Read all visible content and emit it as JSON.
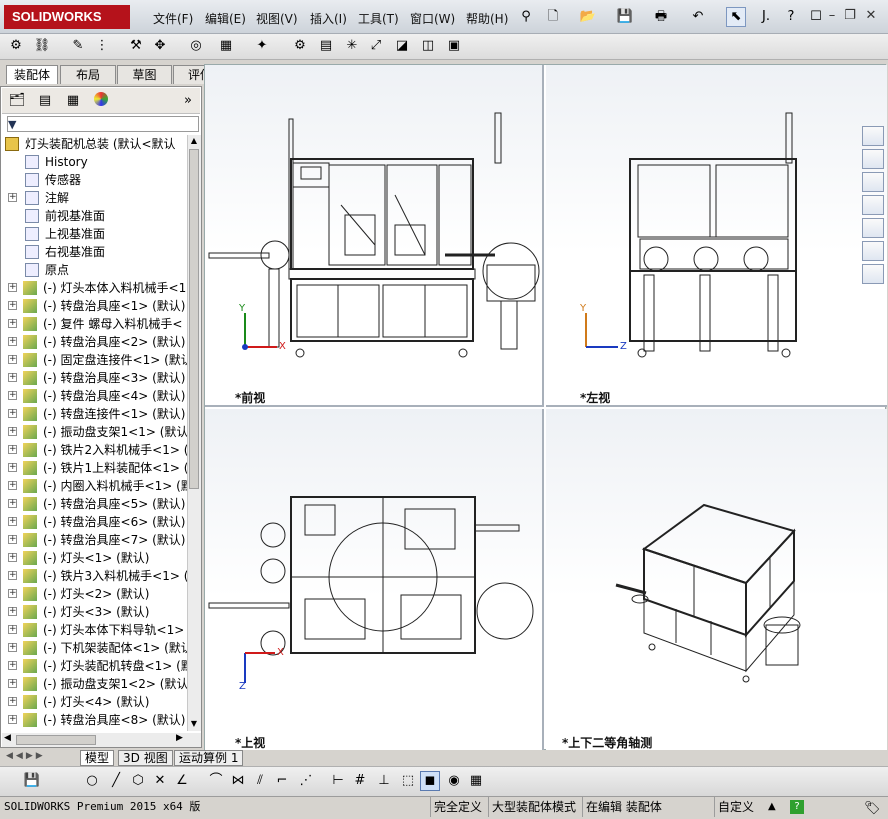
{
  "app": {
    "logo_text": "SOLIDWORKS",
    "brand_color": "#b5121b"
  },
  "menu": [
    "文件(F)",
    "编辑(E)",
    "视图(V)",
    "插入(I)",
    "工具(T)",
    "窗口(W)",
    "帮助(H)"
  ],
  "command_tabs": [
    "装配体",
    "布局",
    "草图",
    "评估"
  ],
  "tree": {
    "root": "灯头装配机总装  (默认<默认",
    "items": [
      {
        "label": "History",
        "icon": "history-icon",
        "expand": false
      },
      {
        "label": "传感器",
        "icon": "sensor-icon",
        "expand": false
      },
      {
        "label": "注解",
        "icon": "annotation-icon",
        "expand": true
      },
      {
        "label": "前视基准面",
        "icon": "plane-icon",
        "expand": false
      },
      {
        "label": "上视基准面",
        "icon": "plane-icon",
        "expand": false
      },
      {
        "label": "右视基准面",
        "icon": "plane-icon",
        "expand": false
      },
      {
        "label": "原点",
        "icon": "origin-icon",
        "expand": false
      },
      {
        "label": "(-) 灯头本体入料机械手<1",
        "icon": "subassembly-icon",
        "expand": true
      },
      {
        "label": "(-) 转盘治具座<1> (默认)",
        "icon": "subassembly-icon",
        "expand": true
      },
      {
        "label": "(-) 复件 螺母入料机械手<",
        "icon": "subassembly-icon",
        "expand": true
      },
      {
        "label": "(-) 转盘治具座<2> (默认)",
        "icon": "subassembly-icon",
        "expand": true
      },
      {
        "label": "(-) 固定盘连接件<1> (默认",
        "icon": "subassembly-icon",
        "expand": true
      },
      {
        "label": "(-) 转盘治具座<3> (默认)",
        "icon": "subassembly-icon",
        "expand": true
      },
      {
        "label": "(-) 转盘治具座<4> (默认)",
        "icon": "subassembly-icon",
        "expand": true
      },
      {
        "label": "(-) 转盘连接件<1> (默认)",
        "icon": "subassembly-icon",
        "expand": true
      },
      {
        "label": "(-) 振动盘支架1<1> (默认",
        "icon": "subassembly-icon",
        "expand": true
      },
      {
        "label": "(-) 铁片2入料机械手<1> (",
        "icon": "subassembly-icon",
        "expand": true
      },
      {
        "label": "(-) 铁片1上料装配体<1> (",
        "icon": "subassembly-icon",
        "expand": true
      },
      {
        "label": "(-) 内圈入料机械手<1> (默",
        "icon": "subassembly-icon",
        "expand": true
      },
      {
        "label": "(-) 转盘治具座<5> (默认)",
        "icon": "subassembly-icon",
        "expand": true
      },
      {
        "label": "(-) 转盘治具座<6> (默认)",
        "icon": "subassembly-icon",
        "expand": true
      },
      {
        "label": "(-) 转盘治具座<7> (默认)",
        "icon": "subassembly-icon",
        "expand": true
      },
      {
        "label": "(-) 灯头<1> (默认)",
        "icon": "subassembly-icon",
        "expand": true
      },
      {
        "label": "(-) 铁片3入料机械手<1> (",
        "icon": "subassembly-icon",
        "expand": true
      },
      {
        "label": "(-) 灯头<2> (默认)",
        "icon": "subassembly-icon",
        "expand": true
      },
      {
        "label": "(-) 灯头<3> (默认)",
        "icon": "subassembly-icon",
        "expand": true
      },
      {
        "label": "(-) 灯头本体下料导轨<1>",
        "icon": "subassembly-icon",
        "expand": true
      },
      {
        "label": "(-) 下机架装配体<1> (默认",
        "icon": "subassembly-icon",
        "expand": true
      },
      {
        "label": "(-) 灯头装配机转盘<1> (默",
        "icon": "subassembly-icon",
        "expand": true
      },
      {
        "label": "(-) 振动盘支架1<2> (默认",
        "icon": "subassembly-icon",
        "expand": true
      },
      {
        "label": "(-) 灯头<4> (默认)",
        "icon": "subassembly-icon",
        "expand": true
      },
      {
        "label": "(-) 转盘治具座<8> (默认)",
        "icon": "subassembly-icon",
        "expand": true
      }
    ]
  },
  "viewports": {
    "front": "*前视",
    "left": "*左视",
    "top": "*上视",
    "iso": "*上下二等角轴测"
  },
  "bottom_tabs": [
    "模型",
    "3D 视图",
    "运动算例 1"
  ],
  "status": {
    "version": "SOLIDWORKS Premium 2015 x64 版",
    "fully_defined": "完全定义",
    "large_assembly": "大型装配体模式",
    "editing": "在编辑 装配体",
    "custom": "自定义"
  },
  "axes": {
    "x": "X",
    "y": "Y",
    "z": "Z"
  }
}
